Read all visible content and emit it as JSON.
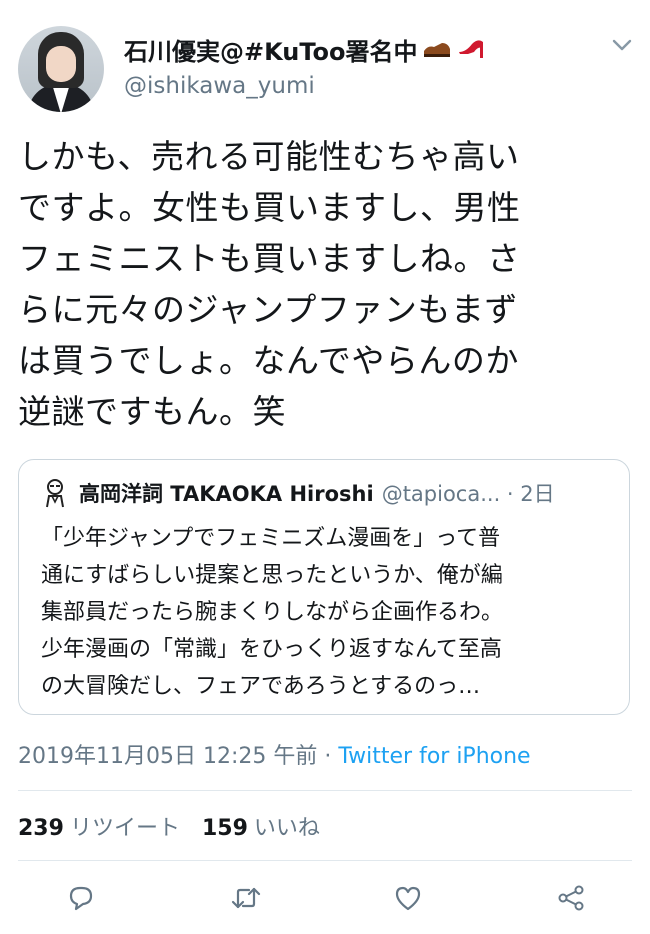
{
  "author": {
    "display_name": "石川優実@#KuToo署名中",
    "handle": "@ishikawa_yumi"
  },
  "tweet": {
    "lines": [
      "しかも、売れる可能性むちゃ高い",
      "ですよ。女性も買いますし、男性",
      "フェミニストも買いますしね。さ",
      "らに元々のジャンプファンもまず",
      "は買うでしょ。なんでやらんのか",
      "逆謎ですもん。笑"
    ]
  },
  "quoted": {
    "name": "高岡洋詞 TAKAOKA Hiroshi",
    "handle_time": "@tapioca... · 2日",
    "lines": [
      "「少年ジャンプでフェミニズム漫画を」って普",
      "通にすばらしい提案と思ったというか、俺が編",
      "集部員だったら腕まくりしながら企画作るわ。",
      "少年漫画の「常識」をひっくり返すなんて至高",
      "の大冒険だし、フェアであろうとするのっ…"
    ]
  },
  "meta": {
    "timestamp": "2019年11月05日 12:25 午前 · ",
    "source": "Twitter for iPhone"
  },
  "stats": {
    "retweets": "239",
    "retweets_label": "リツイート",
    "likes": "159",
    "likes_label": "いいね"
  },
  "icons": {
    "menu": "chevron-down-icon",
    "reply": "reply-icon",
    "retweet": "retweet-icon",
    "like": "heart-icon",
    "share": "share-icon"
  },
  "colors": {
    "link": "#1da1f2",
    "secondary": "#657786",
    "divider": "#e1e8ed"
  }
}
